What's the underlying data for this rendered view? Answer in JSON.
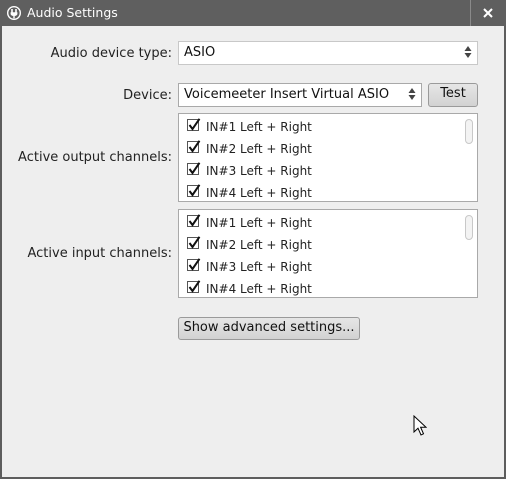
{
  "window": {
    "title": "Audio Settings",
    "close_label": "✕"
  },
  "audio_device_type": {
    "label": "Audio device type:",
    "value": "ASIO"
  },
  "device": {
    "label": "Device:",
    "value": "Voicemeeter Insert Virtual ASIO",
    "test_label": "Test"
  },
  "output_channels": {
    "label": "Active output channels:",
    "items": [
      {
        "label": "IN#1 Left + Right",
        "checked": true
      },
      {
        "label": "IN#2 Left + Right",
        "checked": true
      },
      {
        "label": "IN#3 Left + Right",
        "checked": true
      },
      {
        "label": "IN#4 Left + Right",
        "checked": true
      }
    ]
  },
  "input_channels": {
    "label": "Active input channels:",
    "items": [
      {
        "label": "IN#1 Left + Right",
        "checked": true
      },
      {
        "label": "IN#2 Left + Right",
        "checked": true
      },
      {
        "label": "IN#3 Left + Right",
        "checked": true
      },
      {
        "label": "IN#4 Left + Right",
        "checked": true
      }
    ]
  },
  "advanced_button_label": "Show advanced settings...",
  "icons": {
    "app": "power-plug-icon",
    "close": "close-icon",
    "combo_arrows": "updown-arrows-icon",
    "check": "checkmark-icon",
    "cursor": "mouse-pointer-icon"
  }
}
